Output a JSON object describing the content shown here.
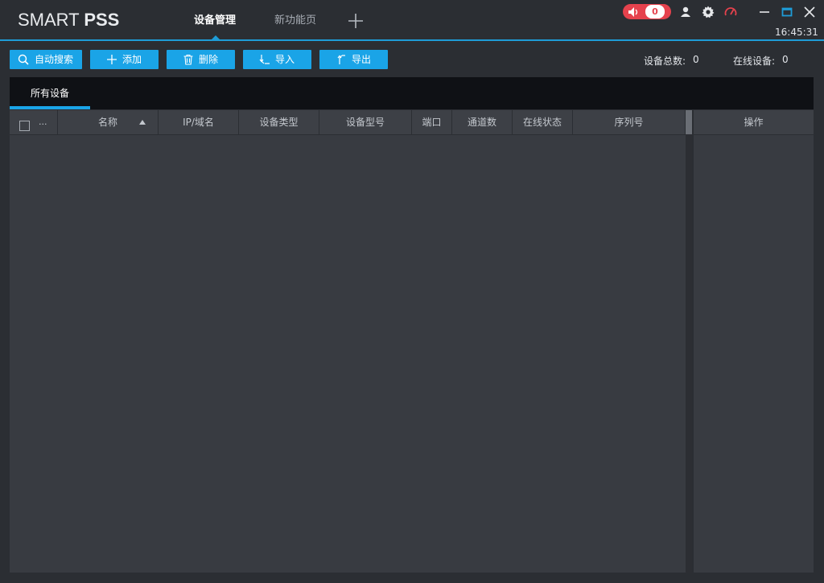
{
  "app": {
    "logo_light": "SMART ",
    "logo_bold": "PSS"
  },
  "tabs": [
    {
      "label": "设备管理",
      "active": true
    },
    {
      "label": "新功能页",
      "active": false
    }
  ],
  "header": {
    "alarm_count": "0",
    "clock": "16:45:31",
    "icons": [
      "speaker-icon",
      "user-icon",
      "gear-icon",
      "gauge-icon",
      "minimize-icon",
      "maximize-icon",
      "close-icon"
    ]
  },
  "toolbar": {
    "auto_search": "自动搜索",
    "add": "添加",
    "delete": "删除",
    "import": "导入",
    "export": "导出"
  },
  "stats": {
    "total_label": "设备总数:",
    "total_value": "0",
    "online_label": "在线设备:",
    "online_value": "0"
  },
  "panel": {
    "tab_label": "所有设备"
  },
  "table": {
    "ellipsis": "...",
    "columns": {
      "name": "名称",
      "ip": "IP/域名",
      "type": "设备类型",
      "model": "设备型号",
      "port": "端口",
      "channels": "通道数",
      "status": "在线状态",
      "serial": "序列号",
      "ops": "操作"
    },
    "rows": []
  },
  "colors": {
    "accent": "#1aa4e7",
    "alarm": "#e5424d",
    "background": "#2b2e33"
  }
}
